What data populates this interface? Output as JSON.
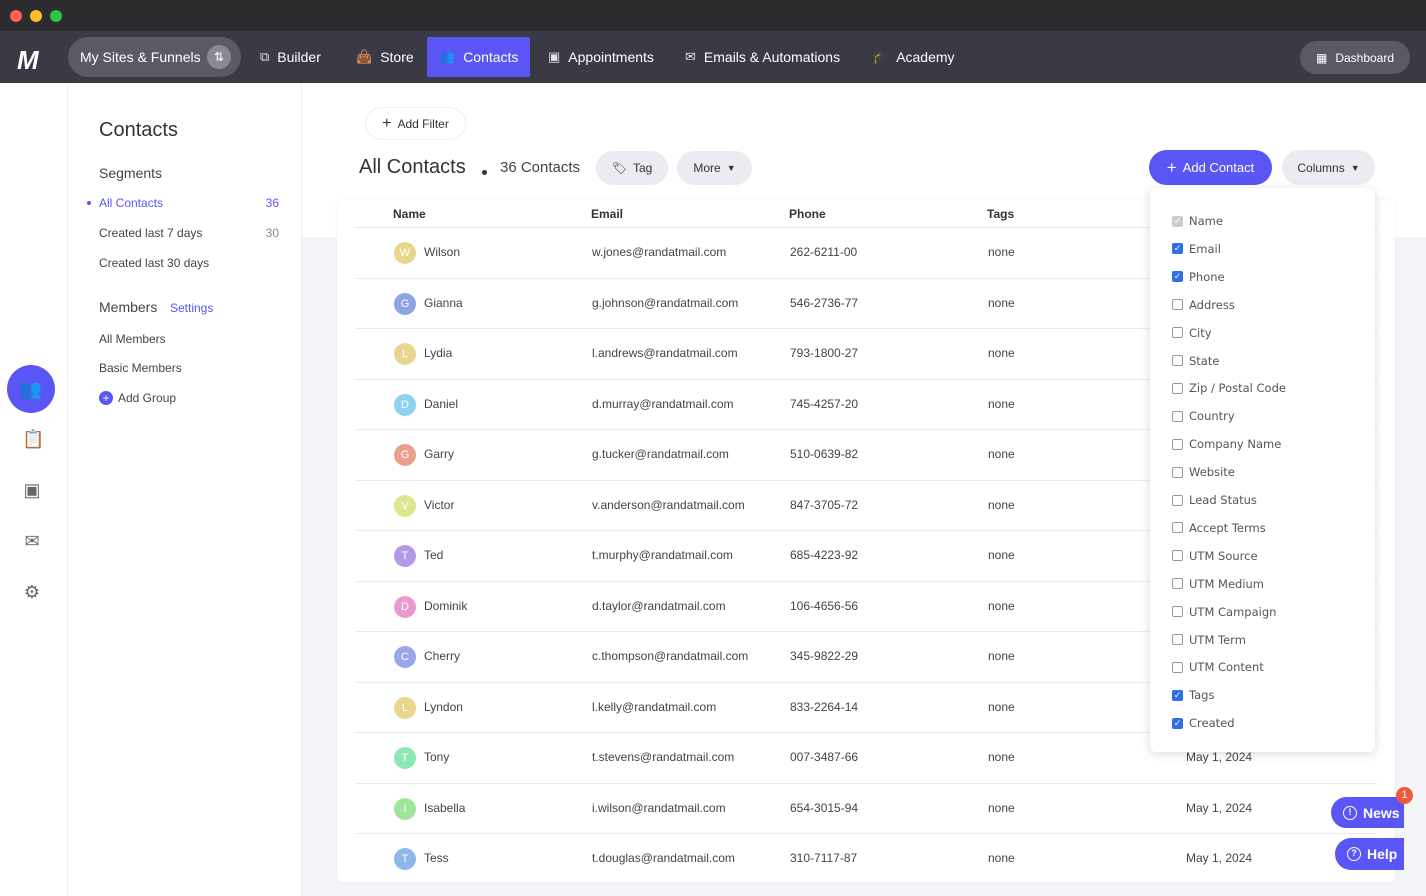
{
  "nav": {
    "sites": "My Sites & Funnels",
    "items": [
      {
        "label": "Builder",
        "icon": "builder-icon"
      },
      {
        "label": "Store",
        "icon": "bag-icon"
      },
      {
        "label": "Contacts",
        "icon": "users-icon",
        "active": true
      },
      {
        "label": "Appointments",
        "icon": "calendar-icon"
      },
      {
        "label": "Emails & Automations",
        "icon": "mail-icon"
      },
      {
        "label": "Academy",
        "icon": "graduation-icon"
      }
    ],
    "dashboard": "Dashboard"
  },
  "sidebar": {
    "title": "Contacts",
    "segments": "Segments",
    "segment_items": [
      {
        "label": "All Contacts",
        "count": "36",
        "active": true
      },
      {
        "label": "Created last 7 days",
        "count": "30"
      },
      {
        "label": "Created last 30 days",
        "count": ""
      }
    ],
    "members": "Members",
    "settings": "Settings",
    "member_items": [
      "All Members",
      "Basic Members"
    ],
    "add_group": "Add Group"
  },
  "toolbar": {
    "add_filter": "Add Filter",
    "title": "All Contacts",
    "count": "36 Contacts",
    "tag": "Tag",
    "more": "More",
    "add_contact": "Add Contact",
    "columns": "Columns"
  },
  "table": {
    "headers": [
      "Name",
      "Email",
      "Phone",
      "Tags"
    ],
    "rows": [
      {
        "initial": "W",
        "name": "Wilson",
        "email": "w.jones@randatmail.com",
        "phone": "262-6211-00",
        "tags": "none",
        "created": "",
        "color": "#e6d68e"
      },
      {
        "initial": "G",
        "name": "Gianna",
        "email": "g.johnson@randatmail.com",
        "phone": "546-2736-77",
        "tags": "none",
        "created": "",
        "color": "#8ea3e6"
      },
      {
        "initial": "L",
        "name": "Lydia",
        "email": "l.andrews@randatmail.com",
        "phone": "793-1800-27",
        "tags": "none",
        "created": "",
        "color": "#e6d68e"
      },
      {
        "initial": "D",
        "name": "Daniel",
        "email": "d.murray@randatmail.com",
        "phone": "745-4257-20",
        "tags": "none",
        "created": "",
        "color": "#8ed2ef"
      },
      {
        "initial": "G",
        "name": "Garry",
        "email": "g.tucker@randatmail.com",
        "phone": "510-0639-82",
        "tags": "none",
        "created": "",
        "color": "#e9a08e"
      },
      {
        "initial": "V",
        "name": "Victor",
        "email": "v.anderson@randatmail.com",
        "phone": "847-3705-72",
        "tags": "none",
        "created": "",
        "color": "#dfe68e"
      },
      {
        "initial": "T",
        "name": "Ted",
        "email": "t.murphy@randatmail.com",
        "phone": "685-4223-92",
        "tags": "none",
        "created": "",
        "color": "#b19be9"
      },
      {
        "initial": "D",
        "name": "Dominik",
        "email": "d.taylor@randatmail.com",
        "phone": "106-4656-56",
        "tags": "none",
        "created": "",
        "color": "#e99bd0"
      },
      {
        "initial": "C",
        "name": "Cherry",
        "email": "c.thompson@randatmail.com",
        "phone": "345-9822-29",
        "tags": "none",
        "created": "",
        "color": "#9ba5e9"
      },
      {
        "initial": "L",
        "name": "Lyndon",
        "email": "l.kelly@randatmail.com",
        "phone": "833-2264-14",
        "tags": "none",
        "created": "",
        "color": "#e6d68e"
      },
      {
        "initial": "T",
        "name": "Tony",
        "email": "t.stevens@randatmail.com",
        "phone": "007-3487-66",
        "tags": "none",
        "created": "May 1, 2024",
        "color": "#8ee6b5"
      },
      {
        "initial": "I",
        "name": "Isabella",
        "email": "i.wilson@randatmail.com",
        "phone": "654-3015-94",
        "tags": "none",
        "created": "May 1, 2024",
        "color": "#9fe69b"
      },
      {
        "initial": "T",
        "name": "Tess",
        "email": "t.douglas@randatmail.com",
        "phone": "310-7117-87",
        "tags": "none",
        "created": "May 1, 2024",
        "color": "#8eb8ea"
      }
    ]
  },
  "columns_menu": [
    {
      "label": "Name",
      "checked": true,
      "disabled": true
    },
    {
      "label": "Email",
      "checked": true
    },
    {
      "label": "Phone",
      "checked": true
    },
    {
      "label": "Address"
    },
    {
      "label": "City"
    },
    {
      "label": "State"
    },
    {
      "label": "Zip / Postal Code"
    },
    {
      "label": "Country"
    },
    {
      "label": "Company Name"
    },
    {
      "label": "Website"
    },
    {
      "label": "Lead Status"
    },
    {
      "label": "Accept Terms"
    },
    {
      "label": "UTM Source"
    },
    {
      "label": "UTM Medium"
    },
    {
      "label": "UTM Campaign"
    },
    {
      "label": "UTM Term"
    },
    {
      "label": "UTM Content"
    },
    {
      "label": "Tags",
      "checked": true
    },
    {
      "label": "Created",
      "checked": true
    }
  ],
  "widgets": {
    "news": "News",
    "news_badge": "1",
    "help": "Help"
  },
  "colors": {
    "accent": "#5a55f5",
    "nav_bg": "#3a3a45"
  }
}
